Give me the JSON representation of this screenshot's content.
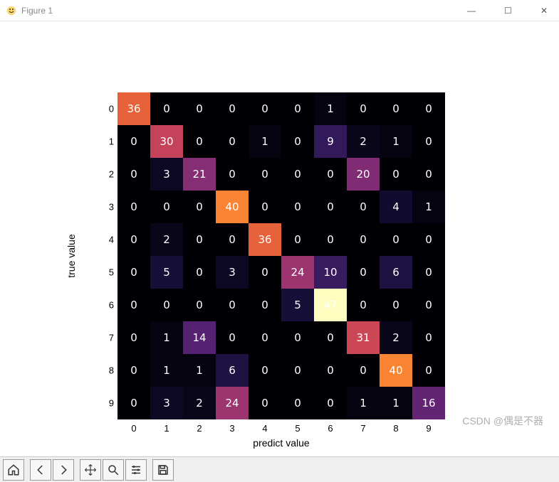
{
  "window": {
    "title": "Figure 1",
    "buttons": {
      "min": "—",
      "max": "☐",
      "close": "✕"
    }
  },
  "watermark": "CSDN @偶是不器",
  "chart_data": {
    "type": "heatmap",
    "title": "",
    "xlabel": "predict value",
    "ylabel": "true value",
    "x_categories": [
      "0",
      "1",
      "2",
      "3",
      "4",
      "5",
      "6",
      "7",
      "8",
      "9"
    ],
    "y_categories": [
      "0",
      "1",
      "2",
      "3",
      "4",
      "5",
      "6",
      "7",
      "8",
      "9"
    ],
    "values": [
      [
        36,
        0,
        0,
        0,
        0,
        0,
        1,
        0,
        0,
        0
      ],
      [
        0,
        30,
        0,
        0,
        1,
        0,
        9,
        2,
        1,
        0
      ],
      [
        0,
        3,
        21,
        0,
        0,
        0,
        0,
        20,
        0,
        0
      ],
      [
        0,
        0,
        0,
        40,
        0,
        0,
        0,
        0,
        4,
        1
      ],
      [
        0,
        2,
        0,
        0,
        36,
        0,
        0,
        0,
        0,
        0
      ],
      [
        0,
        5,
        0,
        3,
        0,
        24,
        10,
        0,
        6,
        0
      ],
      [
        0,
        0,
        0,
        0,
        0,
        5,
        47,
        0,
        0,
        0
      ],
      [
        0,
        1,
        14,
        0,
        0,
        0,
        0,
        31,
        2,
        0
      ],
      [
        0,
        1,
        1,
        6,
        0,
        0,
        0,
        0,
        40,
        0
      ],
      [
        0,
        3,
        2,
        24,
        0,
        0,
        0,
        1,
        1,
        16
      ]
    ],
    "colormap": "magma",
    "value_range": [
      0,
      47
    ],
    "annotate_color": "white"
  },
  "toolbar": {
    "home": "Home",
    "back": "Back",
    "forward": "Forward",
    "pan": "Pan",
    "zoom": "Zoom",
    "configure": "Configure",
    "save": "Save"
  }
}
